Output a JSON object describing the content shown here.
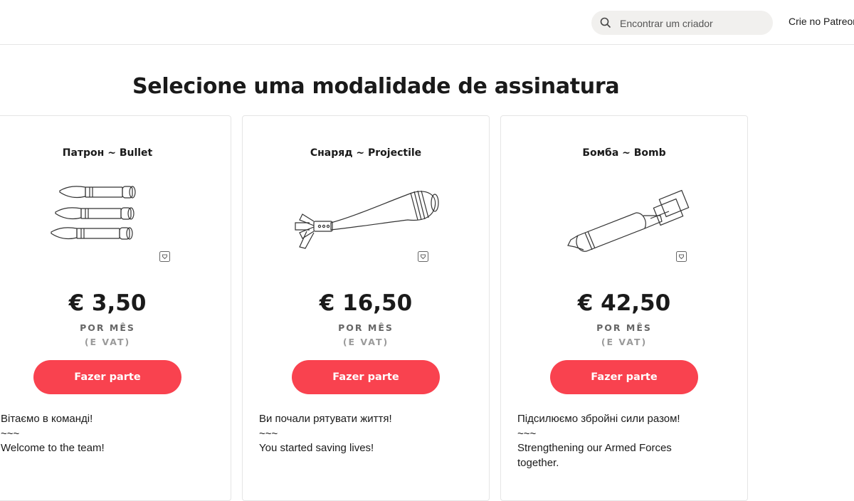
{
  "header": {
    "search_placeholder": "Encontrar um criador",
    "create_link": "Crie no Patreon"
  },
  "page_title": "Selecione uma modalidade de assinatura",
  "tiers": [
    {
      "name": "Патрон ~ Bullet",
      "image_icon": "bullets-icon",
      "price": "€ 3,50",
      "period": "POR MÊS",
      "vat": "(E VAT)",
      "button": "Fazer parte",
      "description": [
        "Вітаємо в команді!",
        "~~~",
        "Welcome to the team!"
      ]
    },
    {
      "name": "Снаряд ~ Projectile",
      "image_icon": "mortar-shell-icon",
      "price": "€ 16,50",
      "period": "POR MÊS",
      "vat": "(E VAT)",
      "button": "Fazer parte",
      "description": [
        "Ви почали рятувати життя!",
        "~~~",
        "You started saving lives!"
      ]
    },
    {
      "name": "Бомба ~ Bomb",
      "image_icon": "bomb-icon",
      "price": "€ 42,50",
      "period": "POR MÊS",
      "vat": "(E VAT)",
      "button": "Fazer parte",
      "description": [
        "Підсилюємо збройні сили разом!",
        "~~~",
        "Strengthening our Armed Forces together."
      ]
    }
  ],
  "colors": {
    "accent": "#f9424f",
    "search_bg": "#f1f0ee",
    "border": "#e5e5e5"
  }
}
